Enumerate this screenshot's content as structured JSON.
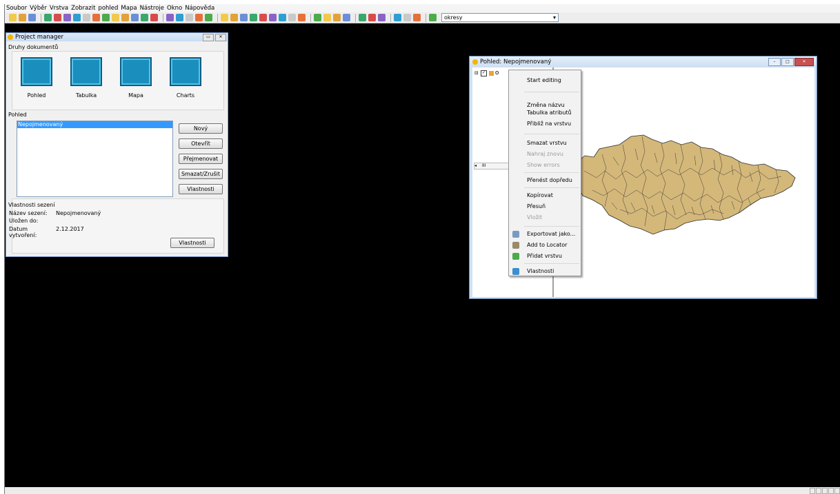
{
  "menubar": [
    "Soubor",
    "Výběr",
    "Vrstva",
    "Zobrazit",
    "pohled",
    "Mapa",
    "Nástroje",
    "Okno",
    "Nápověda"
  ],
  "toolbar": {
    "icons": [
      "new-icon",
      "open-icon",
      "save-icon",
      "pan-icon",
      "zoom-extent-icon",
      "zoom-layer-icon",
      "zoom-box-icon",
      "zoom-in-icon",
      "layers-icon",
      "zoom-out-icon",
      "zoom-prev-icon",
      "zoom-next-icon",
      "zoom-select-icon",
      "add-layer-icon",
      "table-icon",
      "info-icon",
      "measure-icon",
      "print-icon",
      "export-icon",
      "select-icon",
      "select-point-icon",
      "select-rect-icon",
      "select-poly-icon",
      "query-icon",
      "filter-icon",
      "clear-select-icon",
      "edit-icon",
      "snap-icon",
      "stop-icon",
      "tools-icon",
      "graph-icon",
      "geoprocess-icon",
      "locator-icon",
      "grid-icon",
      "catalog-icon",
      "preferences-icon",
      "projection-icon",
      "doc-icon",
      "layout-icon",
      "insert-icon"
    ],
    "combo_value": "okresy"
  },
  "project_manager": {
    "title": "Project manager",
    "doc_types_label": "Druhy dokumentů",
    "doc_types": [
      {
        "label": "Pohled",
        "icon": "view-doc-icon"
      },
      {
        "label": "Tabulka",
        "icon": "table-doc-icon"
      },
      {
        "label": "Mapa",
        "icon": "map-doc-icon"
      },
      {
        "label": "Charts",
        "icon": "charts-doc-icon"
      }
    ],
    "section_label": "Pohled",
    "list_items": [
      "Nepojmenovaný"
    ],
    "buttons": [
      "Nový",
      "Otevřít",
      "Přejmenovat",
      "Smazat/Zrušit",
      "Vlastnosti"
    ],
    "session": {
      "label": "Vlastnosti sezení",
      "rows": [
        {
          "key": "Název sezení:",
          "value": "Nepojmenovaný"
        },
        {
          "key": "Uložen do:",
          "value": ""
        },
        {
          "key": "Datum vytvoření:",
          "value": "2.12.2017"
        }
      ],
      "button": "Vlastnosti"
    }
  },
  "view_window": {
    "title": "Pohled: Nepojmenovaný",
    "toc_layer_initial": "o",
    "scrollbar_text": "III",
    "map_fill": "#d4b87a",
    "map_stroke": "#2a2a2a"
  },
  "context_menu": {
    "items": [
      {
        "label": "Start editing",
        "disabled": false,
        "icon": ""
      },
      {
        "label": "Změna názvu",
        "disabled": false,
        "icon": ""
      },
      {
        "label": "Tabulka atributů",
        "disabled": false,
        "icon": ""
      },
      {
        "label": "Přibliž na vrstvu",
        "disabled": false,
        "icon": ""
      },
      {
        "label": "Smazat vrstvu",
        "disabled": false,
        "icon": ""
      },
      {
        "label": "Nahraj znovu",
        "disabled": true,
        "icon": ""
      },
      {
        "label": "Show errors",
        "disabled": true,
        "icon": ""
      },
      {
        "label": "Přenést dopředu",
        "disabled": false,
        "icon": ""
      },
      {
        "label": "Kopírovat",
        "disabled": false,
        "icon": ""
      },
      {
        "label": "Přesuň",
        "disabled": false,
        "icon": ""
      },
      {
        "label": "Vložit",
        "disabled": true,
        "icon": ""
      },
      {
        "label": "Exportovat jako...",
        "disabled": false,
        "icon": "export-icon"
      },
      {
        "label": "Add to Locator",
        "disabled": false,
        "icon": "locator-icon"
      },
      {
        "label": "Přidat vrstvu",
        "disabled": false,
        "icon": "add-layer-icon"
      },
      {
        "label": "Vlastnosti",
        "disabled": false,
        "icon": "properties-icon"
      }
    ]
  }
}
